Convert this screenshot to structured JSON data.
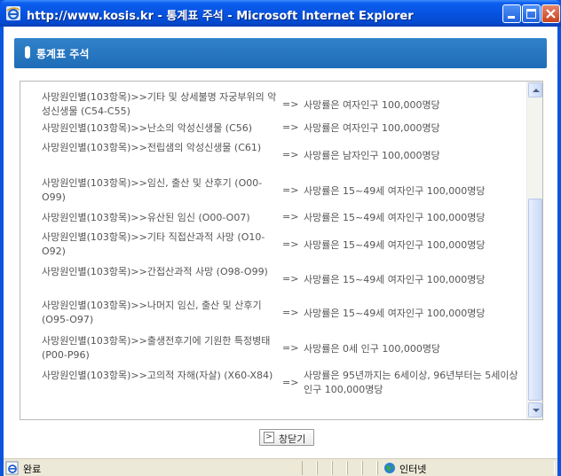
{
  "window": {
    "title": "http://www.kosis.kr - 통계표 주석 - Microsoft Internet Explorer",
    "colors": {
      "titlebar": "#0653e0",
      "header": "#2a78c2",
      "statusbar": "#ece9d8"
    }
  },
  "header": {
    "title": "통계표 주석"
  },
  "notes": [
    {
      "category": "사망원인별(103항목)>>기타 및 상세불명 자궁부위의 악성신생물 (C54-C55)",
      "arrow": "=>",
      "value": "사망률은 여자인구 100,000명당"
    },
    {
      "category": "사망원인별(103항목)>>난소의 악성신생물 (C56)",
      "arrow": "=>",
      "value": "사망률은 여자인구 100,000명당"
    },
    {
      "category": "사망원인별(103항목)>>전립샘의 악성신생물 (C61)",
      "arrow": "=>",
      "value": "사망률은 남자인구 100,000명당"
    },
    {
      "category": "사망원인별(103항목)>>임신, 출산 및 산후기 (O00-O99)",
      "arrow": "=>",
      "value": "사망률은 15~49세 여자인구 100,000명당"
    },
    {
      "category": "사망원인별(103항목)>>유산된 임신 (O00-O07)",
      "arrow": "=>",
      "value": "사망률은 15~49세 여자인구 100,000명당"
    },
    {
      "category": "사망원인별(103항목)>>기타 직접산과적 사망 (O10-O92)",
      "arrow": "=>",
      "value": "사망률은 15~49세 여자인구 100,000명당"
    },
    {
      "category": "사망원인별(103항목)>>간접산과적 사망 (O98-O99)",
      "arrow": "=>",
      "value": "사망률은 15~49세 여자인구 100,000명당"
    },
    {
      "category": "사망원인별(103항목)>>나머지 임신, 출산 및 산후기 (O95-O97)",
      "arrow": "=>",
      "value": "사망률은 15~49세 여자인구 100,000명당"
    },
    {
      "category": "사망원인별(103항목)>>출생전후기에 기원한 특정병태 (P00-P96)",
      "arrow": "=>",
      "value": "사망률은 0세 인구 100,000명당"
    },
    {
      "category": "사망원인별(103항목)>>고의적 자해(자살) (X60-X84)",
      "arrow": "=>",
      "value": "사망률은 95년까지는 6세이상, 96년부터는 5세이상 인구 100,000명당"
    }
  ],
  "buttons": {
    "close": "창닫기",
    "close_chevron": ">"
  },
  "statusbar": {
    "status": "완료",
    "zone": "인터넷"
  },
  "icons": {
    "title": "ie-icon",
    "status": "ie-page-icon",
    "zone": "globe-icon"
  }
}
